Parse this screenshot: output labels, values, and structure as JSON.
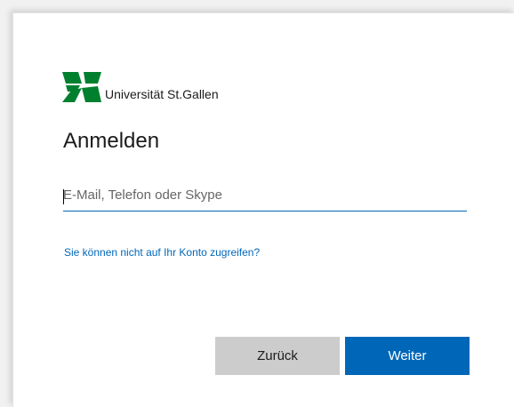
{
  "logo": {
    "text": "Universität St.Gallen",
    "color": "#00802f"
  },
  "signin": {
    "title": "Anmelden",
    "input_value": "",
    "input_placeholder": "E-Mail, Telefon oder Skype",
    "help_link": "Sie können nicht auf Ihr Konto zugreifen?"
  },
  "buttons": {
    "back_label": "Zurück",
    "next_label": "Weiter"
  },
  "colors": {
    "accent": "#0067b8",
    "secondary_button": "#cccccc"
  }
}
